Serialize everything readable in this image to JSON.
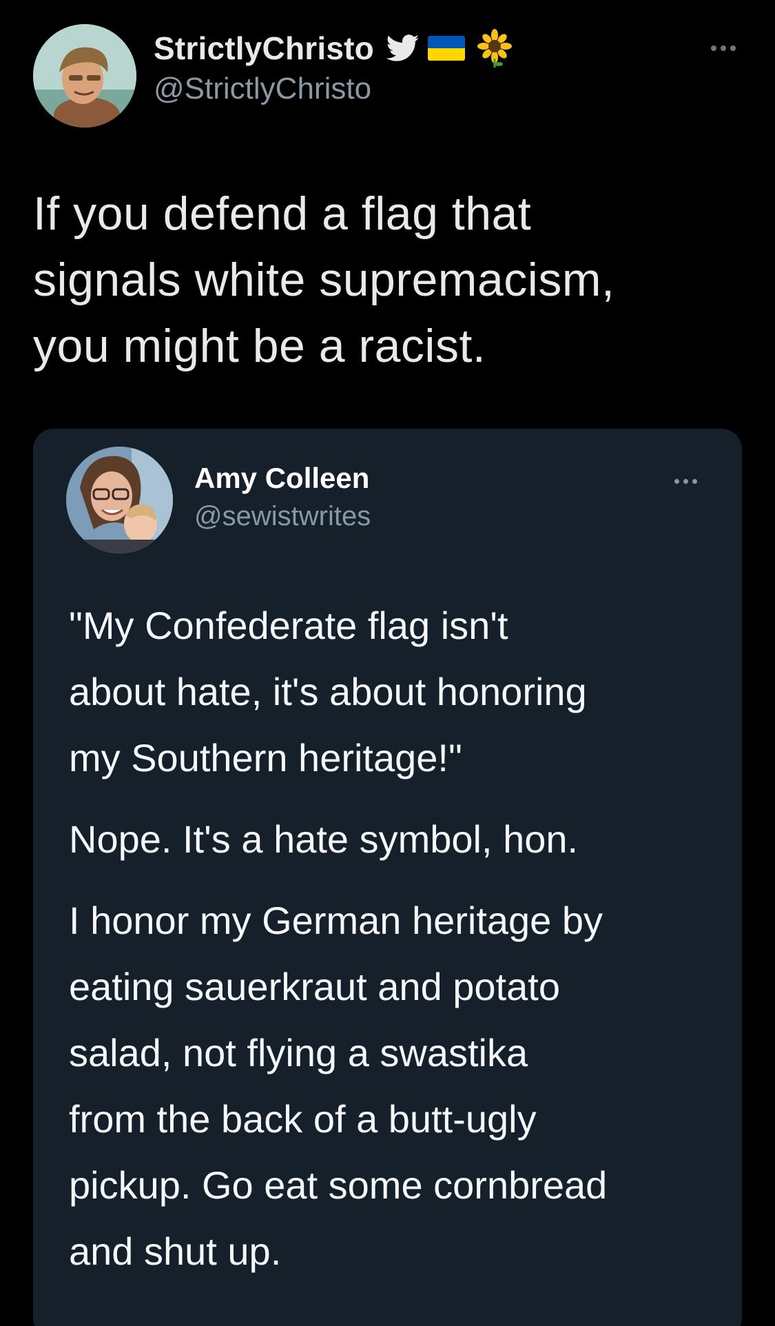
{
  "tweet": {
    "author": {
      "display_name": "StrictlyChristo",
      "handle": "@StrictlyChristo",
      "badges": [
        "twitter-bird-icon",
        "ukraine-flag-icon",
        "sunflower-icon"
      ]
    },
    "text_lines": [
      "If you defend a flag that",
      "signals white supremacism,",
      "you might be a racist."
    ]
  },
  "quoted_tweet": {
    "author": {
      "display_name": "Amy Colleen",
      "handle": "@sewistwrites"
    },
    "paragraphs": [
      [
        "\"My Confederate flag isn't",
        "about hate, it's about honoring",
        "my Southern heritage!\""
      ],
      [
        "Nope. It's a hate symbol, hon."
      ],
      [
        "I honor my German heritage by",
        "eating sauerkraut and potato",
        "salad, not flying a swastika",
        "from the back of a butt-ugly",
        "pickup. Go eat some cornbread",
        "and shut up."
      ]
    ]
  },
  "colors": {
    "background": "#000000",
    "primary_text": "#e7e9ea",
    "secondary_text": "#8b98a5",
    "quote_card_bg": "#15202b",
    "twitter_blue": "#1d9bf0",
    "ukraine_blue": "#0057b7",
    "ukraine_yellow": "#ffd700"
  }
}
